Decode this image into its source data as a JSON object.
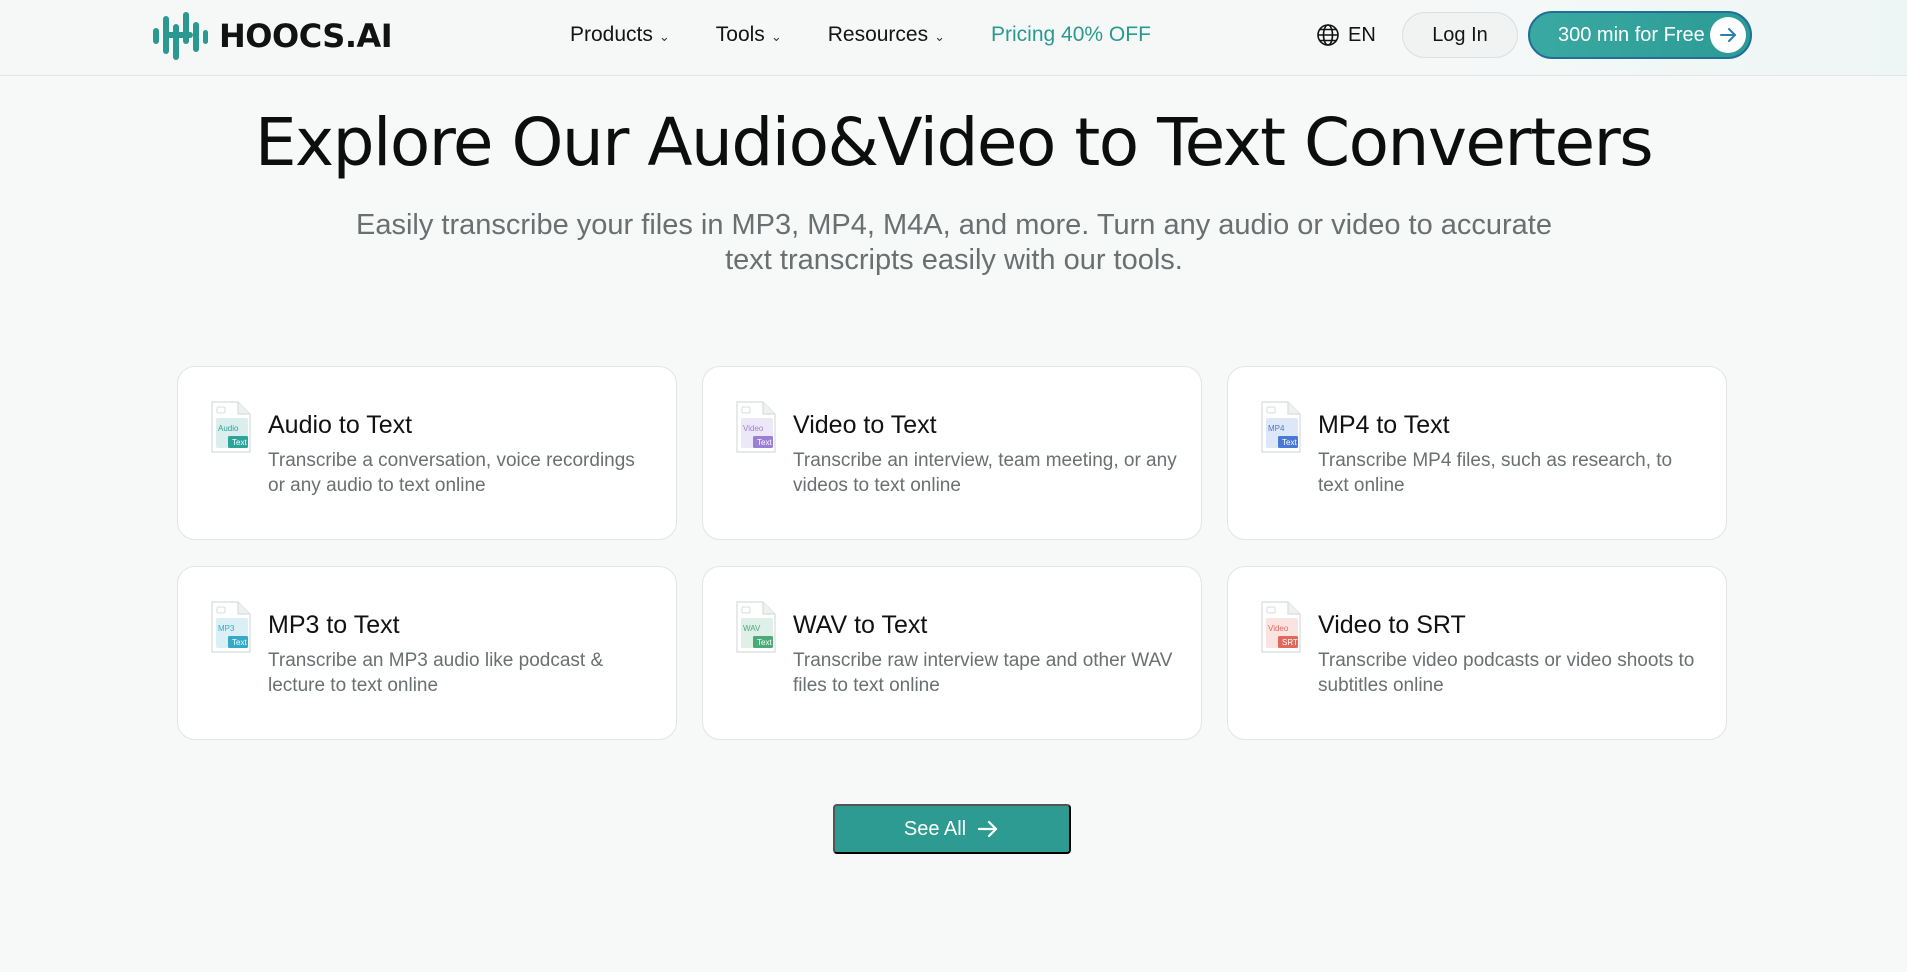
{
  "nav": {
    "logo_text": "HOOCS.AI",
    "items": [
      {
        "label": "Products",
        "has_dropdown": true
      },
      {
        "label": "Tools",
        "has_dropdown": true
      },
      {
        "label": "Resources",
        "has_dropdown": true
      }
    ],
    "pricing_label": "Pricing 40% OFF",
    "language": "EN",
    "login_label": "Log In",
    "cta_label": "300 min for Free"
  },
  "hero": {
    "title": "Explore Our Audio&Video to Text Converters",
    "subtitle_line1": "Easily transcribe your files in MP3, MP4, M4A, and more. Turn any audio or video to accurate",
    "subtitle_line2": "text transcripts easily with our tools."
  },
  "cards": [
    {
      "title": "Audio to Text",
      "desc": "Transcribe a conversation, voice recordings or any audio to text online",
      "icon_label": "Audio",
      "icon_sub": "Text",
      "icon": "audio-file-icon",
      "color": "#2ea39a"
    },
    {
      "title": "Video to Text",
      "desc": "Transcribe an interview, team meeting, or any videos to text online",
      "icon_label": "Video",
      "icon_sub": "Text",
      "icon": "video-file-icon",
      "color": "#9b7fd6"
    },
    {
      "title": "MP4 to Text",
      "desc": "Transcribe MP4 files, such as research, to text online",
      "icon_label": "MP4",
      "icon_sub": "Text",
      "icon": "mp4-file-icon",
      "color": "#4a78d6"
    },
    {
      "title": "MP3 to Text",
      "desc": "Transcribe an MP3 audio like podcast & lecture to text online",
      "icon_label": "MP3",
      "icon_sub": "Text",
      "icon": "mp3-file-icon",
      "color": "#33aac8"
    },
    {
      "title": "WAV to Text",
      "desc": "Transcribe raw interview tape and other WAV files to text online",
      "icon_label": "WAV",
      "icon_sub": "Text",
      "icon": "wav-file-icon",
      "color": "#4aaa78"
    },
    {
      "title": "Video to SRT",
      "desc": "Transcribe video podcasts or video shoots to subtitles online",
      "icon_label": "Video",
      "icon_sub": "SRT",
      "icon": "srt-file-icon",
      "color": "#e2685a"
    }
  ],
  "see_all_label": "See All",
  "colors": {
    "brand": "#2e9b92",
    "accent_text": "#2a9a90"
  }
}
